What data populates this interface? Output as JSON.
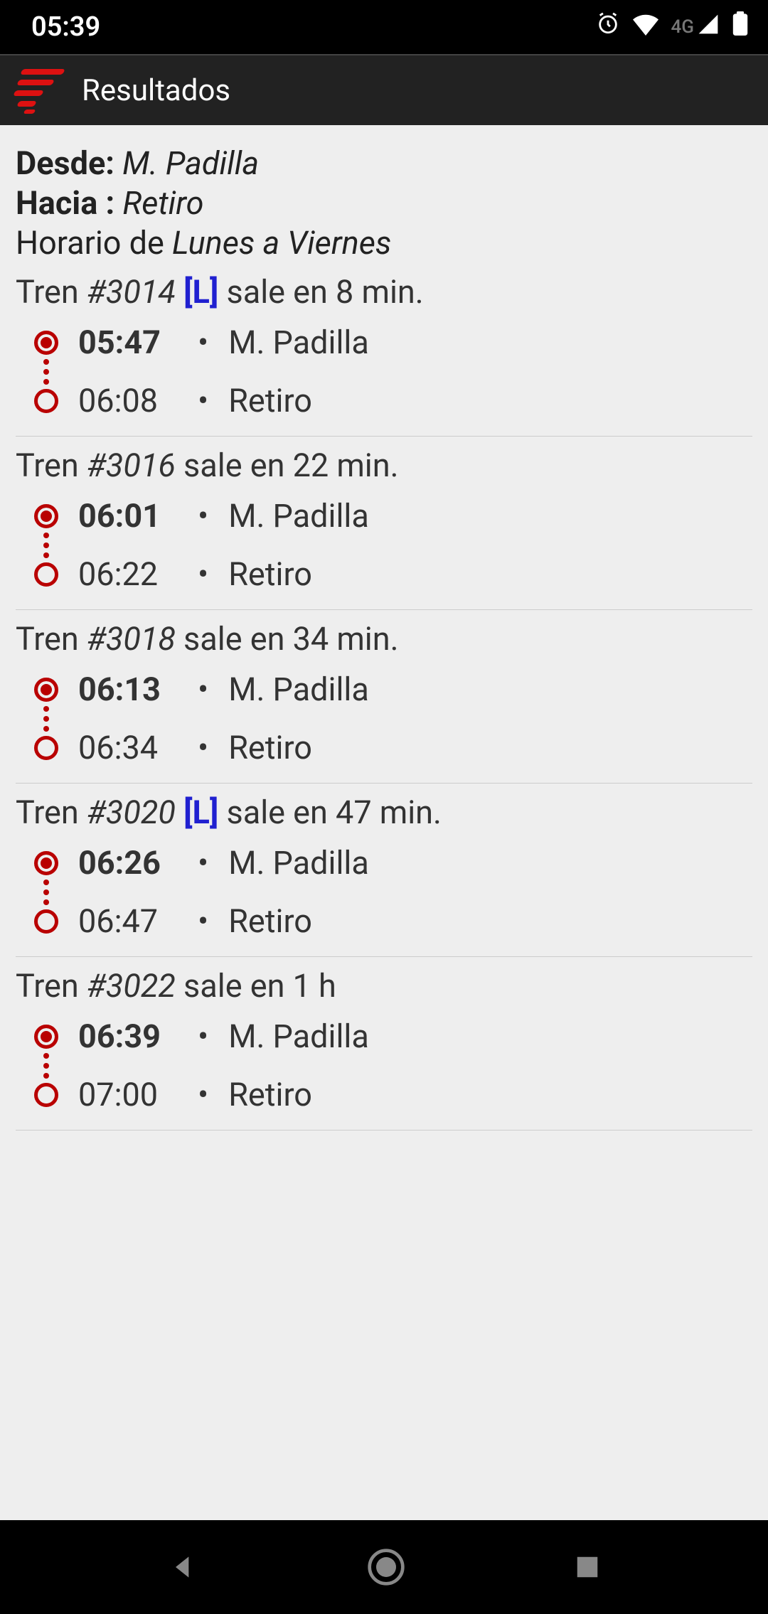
{
  "status": {
    "time": "05:39",
    "network": "4G"
  },
  "appbar": {
    "title": "Resultados"
  },
  "route": {
    "from_label": "Desde: ",
    "from": "M. Padilla",
    "to_label": "Hacia : ",
    "to": "Retiro",
    "schedule_prefix": "Horario de ",
    "schedule": "Lunes a Viernes"
  },
  "trains": [
    {
      "prefix": "Tren ",
      "num": "#3014",
      "tag": "[L]",
      "suffix": " sale en 8 min.",
      "dep_time": "05:47",
      "dep_station": "M. Padilla",
      "arr_time": "06:08",
      "arr_station": "Retiro"
    },
    {
      "prefix": "Tren ",
      "num": "#3016",
      "tag": "",
      "suffix": " sale en 22 min.",
      "dep_time": "06:01",
      "dep_station": "M. Padilla",
      "arr_time": "06:22",
      "arr_station": "Retiro"
    },
    {
      "prefix": "Tren ",
      "num": "#3018",
      "tag": "",
      "suffix": " sale en 34 min.",
      "dep_time": "06:13",
      "dep_station": "M. Padilla",
      "arr_time": "06:34",
      "arr_station": "Retiro"
    },
    {
      "prefix": "Tren ",
      "num": "#3020",
      "tag": "[L]",
      "suffix": " sale en 47 min.",
      "dep_time": "06:26",
      "dep_station": "M. Padilla",
      "arr_time": "06:47",
      "arr_station": "Retiro"
    },
    {
      "prefix": "Tren ",
      "num": "#3022",
      "tag": "",
      "suffix": " sale en 1 h",
      "dep_time": "06:39",
      "dep_station": "M. Padilla",
      "arr_time": "07:00",
      "arr_station": "Retiro"
    }
  ]
}
